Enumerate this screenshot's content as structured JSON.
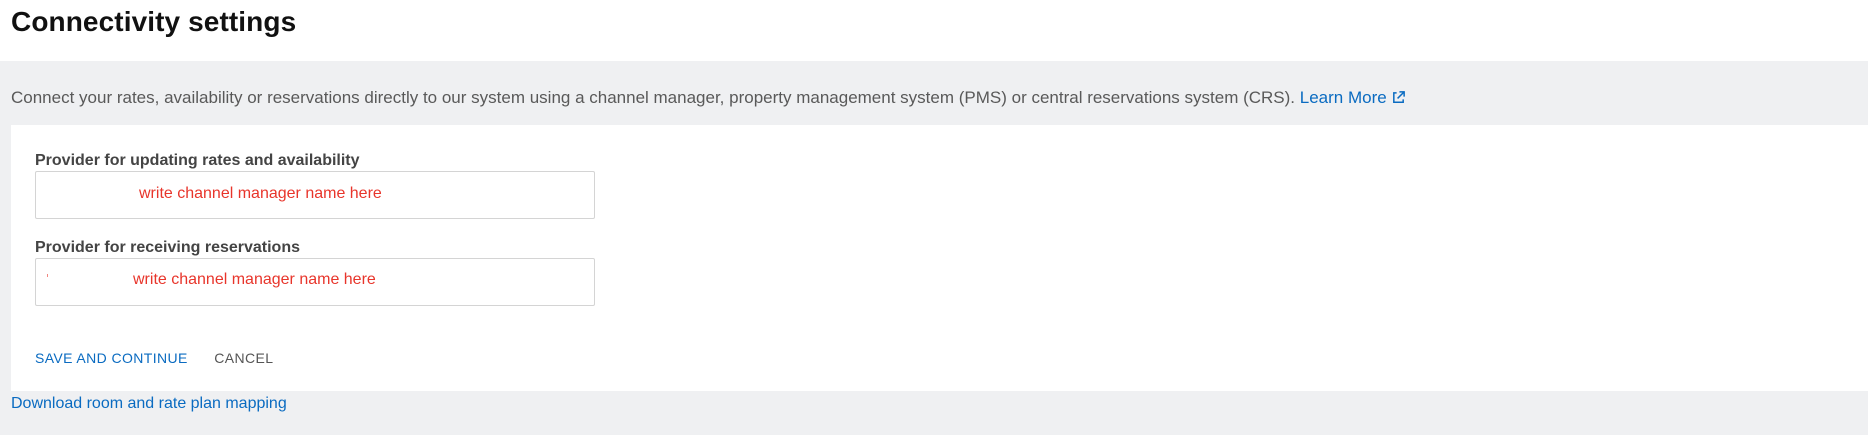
{
  "page": {
    "title": "Connectivity settings"
  },
  "intro": {
    "description": "Connect your rates, availability or reservations directly to our system using a channel manager, property management system (PMS) or central reservations system (CRS).",
    "learn_more_label": "Learn More",
    "learn_more_icon": "external-link-icon"
  },
  "form": {
    "rates_provider": {
      "label": "Provider for updating rates and availability",
      "value": "write channel manager name here"
    },
    "reservations_provider": {
      "label": "Provider for receiving reservations",
      "value": "write channel manager name here"
    },
    "save_label": "SAVE AND CONTINUE",
    "cancel_label": "CANCEL"
  },
  "footer": {
    "download_link_label": "Download room and rate plan mapping"
  },
  "colors": {
    "link": "#0a6bc1",
    "annotation": "#e8352b",
    "background": "#eff0f2",
    "card": "#ffffff"
  }
}
